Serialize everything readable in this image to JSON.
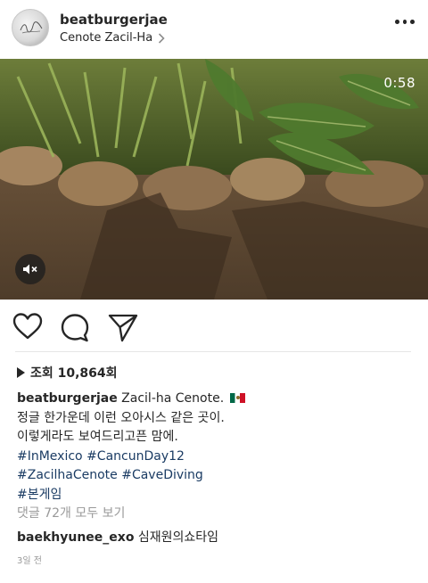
{
  "header": {
    "username": "beatburgerjae",
    "location": "Cenote Zacil-Ha",
    "location_chevron": "chevron-right-icon",
    "more_icon": "more-dots-icon"
  },
  "video": {
    "timer": "0:58",
    "mute_icon": "speaker-muted-icon"
  },
  "actions": {
    "like_icon": "heart-icon",
    "comment_icon": "comment-bubble-icon",
    "share_icon": "paper-plane-icon"
  },
  "post": {
    "views_label": "조회 10,864회",
    "caption_author": "beatburgerjae",
    "caption_text": "Zacil-ha Cenote.",
    "caption_emoji": "mexico-flag-icon",
    "caption_lines": [
      "정글 한가운데 이런 오아시스 같은 곳이.",
      "이렇게라도 보여드리고픈 맘에."
    ],
    "hashtags": [
      "#InMexico #CancunDay12",
      "#ZacilhaCenote #CaveDiving",
      "#본게임"
    ],
    "comments_link": "댓글 72개 모두 보기",
    "comment_author": "baekhyunee_exo",
    "comment_text": "심재원의쇼타임",
    "timestamp": "3일 전"
  },
  "colors": {
    "text": "#262626",
    "muted": "#999999",
    "hashtag": "#1a3b63",
    "divider": "#e6e6e6"
  }
}
